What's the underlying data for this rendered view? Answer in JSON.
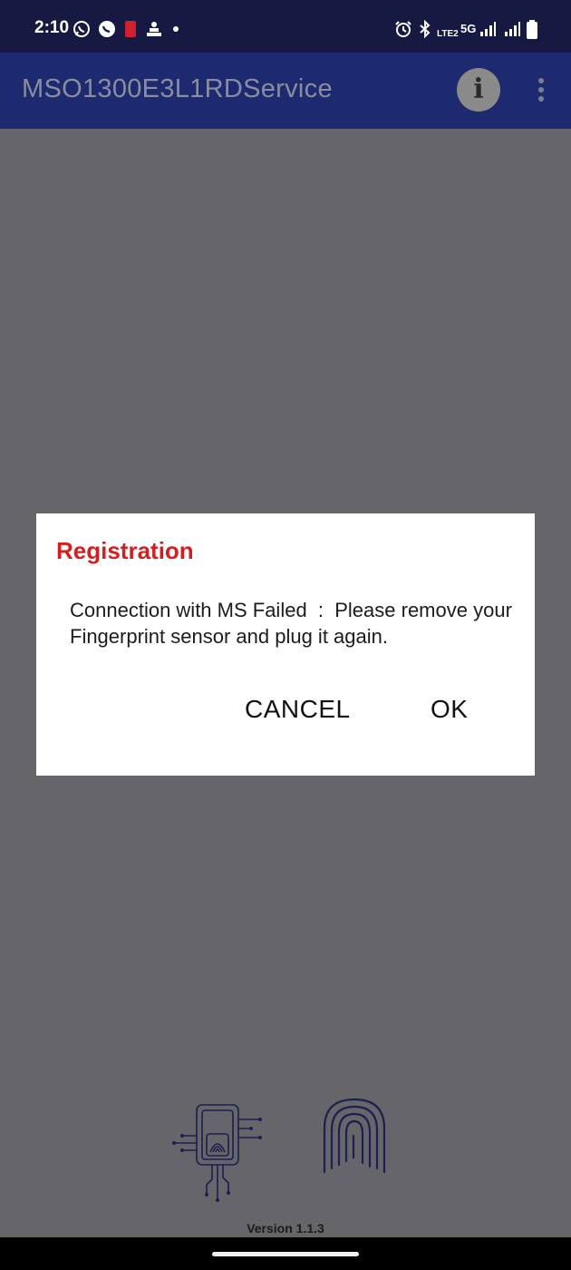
{
  "status_bar": {
    "time": "2:10",
    "network_label": "5G",
    "volte_label": "LTE2",
    "left_icons": [
      "whatsapp-icon",
      "whatsapp-business-icon",
      "red-app-icon",
      "app-icon",
      "notification-dot-icon"
    ],
    "right_icons": [
      "alarm-icon",
      "bluetooth-icon",
      "volte-icon",
      "signal-icon",
      "signal-icon",
      "battery-icon"
    ]
  },
  "app_bar": {
    "title": "MSO1300E3L1RDService",
    "info_glyph": "i",
    "actions": [
      "info-icon",
      "overflow-menu-icon"
    ]
  },
  "dialog": {
    "title": "Registration",
    "message": "Connection with MS Failed  :  Please remove your Fingerprint sensor and plug it again.",
    "cancel_label": "CANCEL",
    "ok_label": "OK"
  },
  "footer": {
    "version": "Version 1.1.3"
  },
  "colors": {
    "status_bar": "#161a42",
    "app_bar": "#1e2a70",
    "scrim": "#666569",
    "dialog_title": "#d31f1f",
    "illustration": "#1c1f52"
  }
}
